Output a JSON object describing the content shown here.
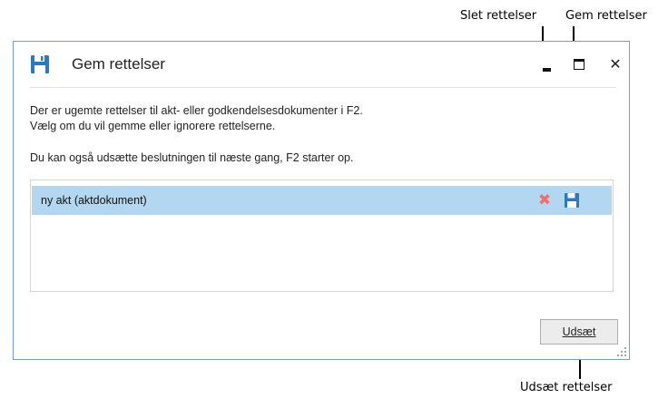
{
  "callouts": {
    "delete_label": "Slet rettelser",
    "save_label": "Gem rettelser",
    "postpone_label": "Udsæt rettelser"
  },
  "window": {
    "title": "Gem rettelser",
    "icon": "floppy-disk-icon",
    "close_glyph": "✕"
  },
  "message": {
    "line1": "Der er ugemte rettelser til akt- eller godkendelsesdokumenter i F2.",
    "line2": "Vælg om du vil gemme eller ignorere rettelserne.",
    "line3": "Du kan også udsætte beslutningen til næste gang, F2 starter op."
  },
  "list": {
    "items": [
      {
        "label": "ny akt (aktdokument)",
        "delete_icon": "delete-x-icon",
        "save_icon": "floppy-disk-icon"
      }
    ]
  },
  "footer": {
    "postpone_button": "Udsæt"
  },
  "colors": {
    "accent": "#2b79c2",
    "row_highlight": "#b3d7f1",
    "delete_red": "#f07070"
  }
}
